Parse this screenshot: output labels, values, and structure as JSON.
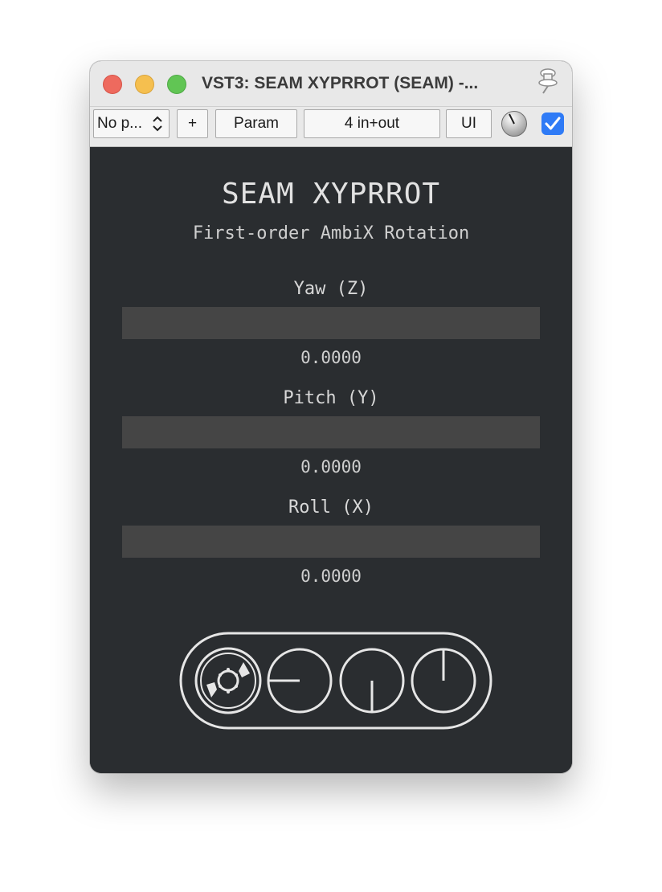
{
  "window": {
    "title": "VST3: SEAM XYPRROT (SEAM) -..."
  },
  "toolbar": {
    "preset_label": "No p...",
    "add_label": "+",
    "param_label": "Param",
    "io_label": "4 in+out",
    "ui_label": "UI",
    "bypass_checked": true
  },
  "plugin": {
    "title": "SEAM XYPRROT",
    "subtitle": "First-order AmbiX Rotation",
    "params": [
      {
        "label": "Yaw (Z)",
        "value": "0.0000",
        "fraction": 0
      },
      {
        "label": "Pitch (Y)",
        "value": "0.0000",
        "fraction": 0
      },
      {
        "label": "Roll (X)",
        "value": "0.0000",
        "fraction": 0
      }
    ]
  },
  "colors": {
    "background": "#2a2d30",
    "slider_track": "#454545",
    "text": "#d6d6d6",
    "checkbox": "#2f7bf6"
  },
  "icons": {
    "logo": "seam-logo-icon",
    "pin": "pin-icon",
    "knob": "knob-icon"
  }
}
